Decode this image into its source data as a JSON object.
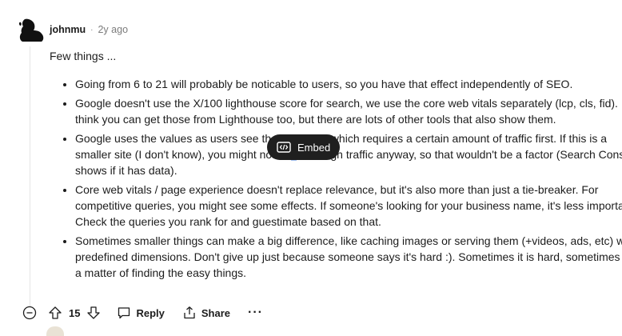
{
  "comment": {
    "username": "johnmu",
    "separator": "·",
    "time": "2y ago",
    "intro": "Few things ...",
    "points": [
      "Going from 6 to 21 will probably be noticable to users, so you have that effect independently of SEO.",
      "Google doesn't use the X/100 lighthouse score for search, we use the core web vitals separately (lcp, cls, fid). I think you can get those from Lighthouse too, but there are lots of other tools that also show them.",
      {
        "before": "Google uses the values as users see them (CrUX), which requires a certain amount of traffic first. If this is a smaller site (I don't know), you might not ha",
        "selected": "v",
        "after": "e enough traffic anyway, so that wouldn't be a factor (Search Console shows if it has data)."
      },
      "Core web vitals / page experience doesn't replace relevance, but it's also more than just a tie-breaker. For competitive queries, you might see some effects. If someone's looking for your business name, it's less important. Check the queries you rank for and guestimate based on that.",
      "Sometimes smaller things can make a big difference, like caching images or serving them (+videos, ads, etc) with predefined dimensions. Don't give up just because someone says it's hard :). Sometimes it is hard, sometimes it's a matter of finding the easy things."
    ]
  },
  "embed_tooltip": {
    "label": "Embed",
    "icon": "code-embed-icon"
  },
  "actions": {
    "vote_count": "15",
    "reply_label": "Reply",
    "share_label": "Share",
    "more_label": "···"
  },
  "colors": {
    "text": "#1c1c1c",
    "muted": "#7c7c7c",
    "tooltip_bg": "#1f1f1f",
    "selection": "#a8c5f5"
  }
}
